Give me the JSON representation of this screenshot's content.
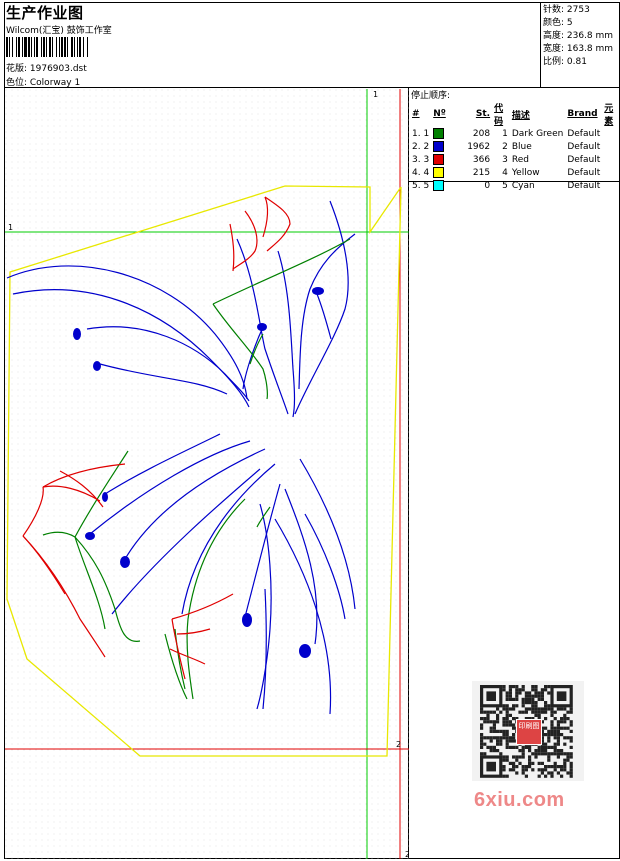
{
  "header": {
    "title": "生产作业图",
    "studio": "Wilcom(汇宝) 鼓饰工作室",
    "design_label": "花版: 1976903.dst",
    "colorway_label": "色位: Colorway 1"
  },
  "stats": {
    "stitches": "针数: 2753",
    "colors": "颜色: 5",
    "height": "高度: 236.8 mm",
    "width": "宽度: 163.8 mm",
    "scale": "比例: 0.81"
  },
  "sequence": {
    "heading": "停止顺序:",
    "columns": [
      "#",
      "Nº",
      "St.",
      "代码",
      "描述",
      "Brand",
      "元素"
    ],
    "rows": [
      {
        "idx": "1. 1",
        "color": "#008000",
        "stitches": "208",
        "code": "1",
        "desc": "Dark Green",
        "brand": "Default"
      },
      {
        "idx": "2. 2",
        "color": "#0000cc",
        "stitches": "1962",
        "code": "2",
        "desc": "Blue",
        "brand": "Default"
      },
      {
        "idx": "3. 3",
        "color": "#e00000",
        "stitches": "366",
        "code": "3",
        "desc": "Red",
        "brand": "Default"
      },
      {
        "idx": "4. 4",
        "color": "#ffff00",
        "stitches": "215",
        "code": "4",
        "desc": "Yellow",
        "brand": "Default"
      },
      {
        "idx": "5. 5",
        "color": "#00ffff",
        "stitches": "0",
        "code": "5",
        "desc": "Cyan",
        "brand": "Default"
      }
    ]
  },
  "guides": {
    "vertical_top_label": "1",
    "horizontal_left_label": "1",
    "corner_label": "2",
    "bottom_label": "2"
  },
  "watermark": "6xiu.com",
  "qr_badge": "印刷图"
}
